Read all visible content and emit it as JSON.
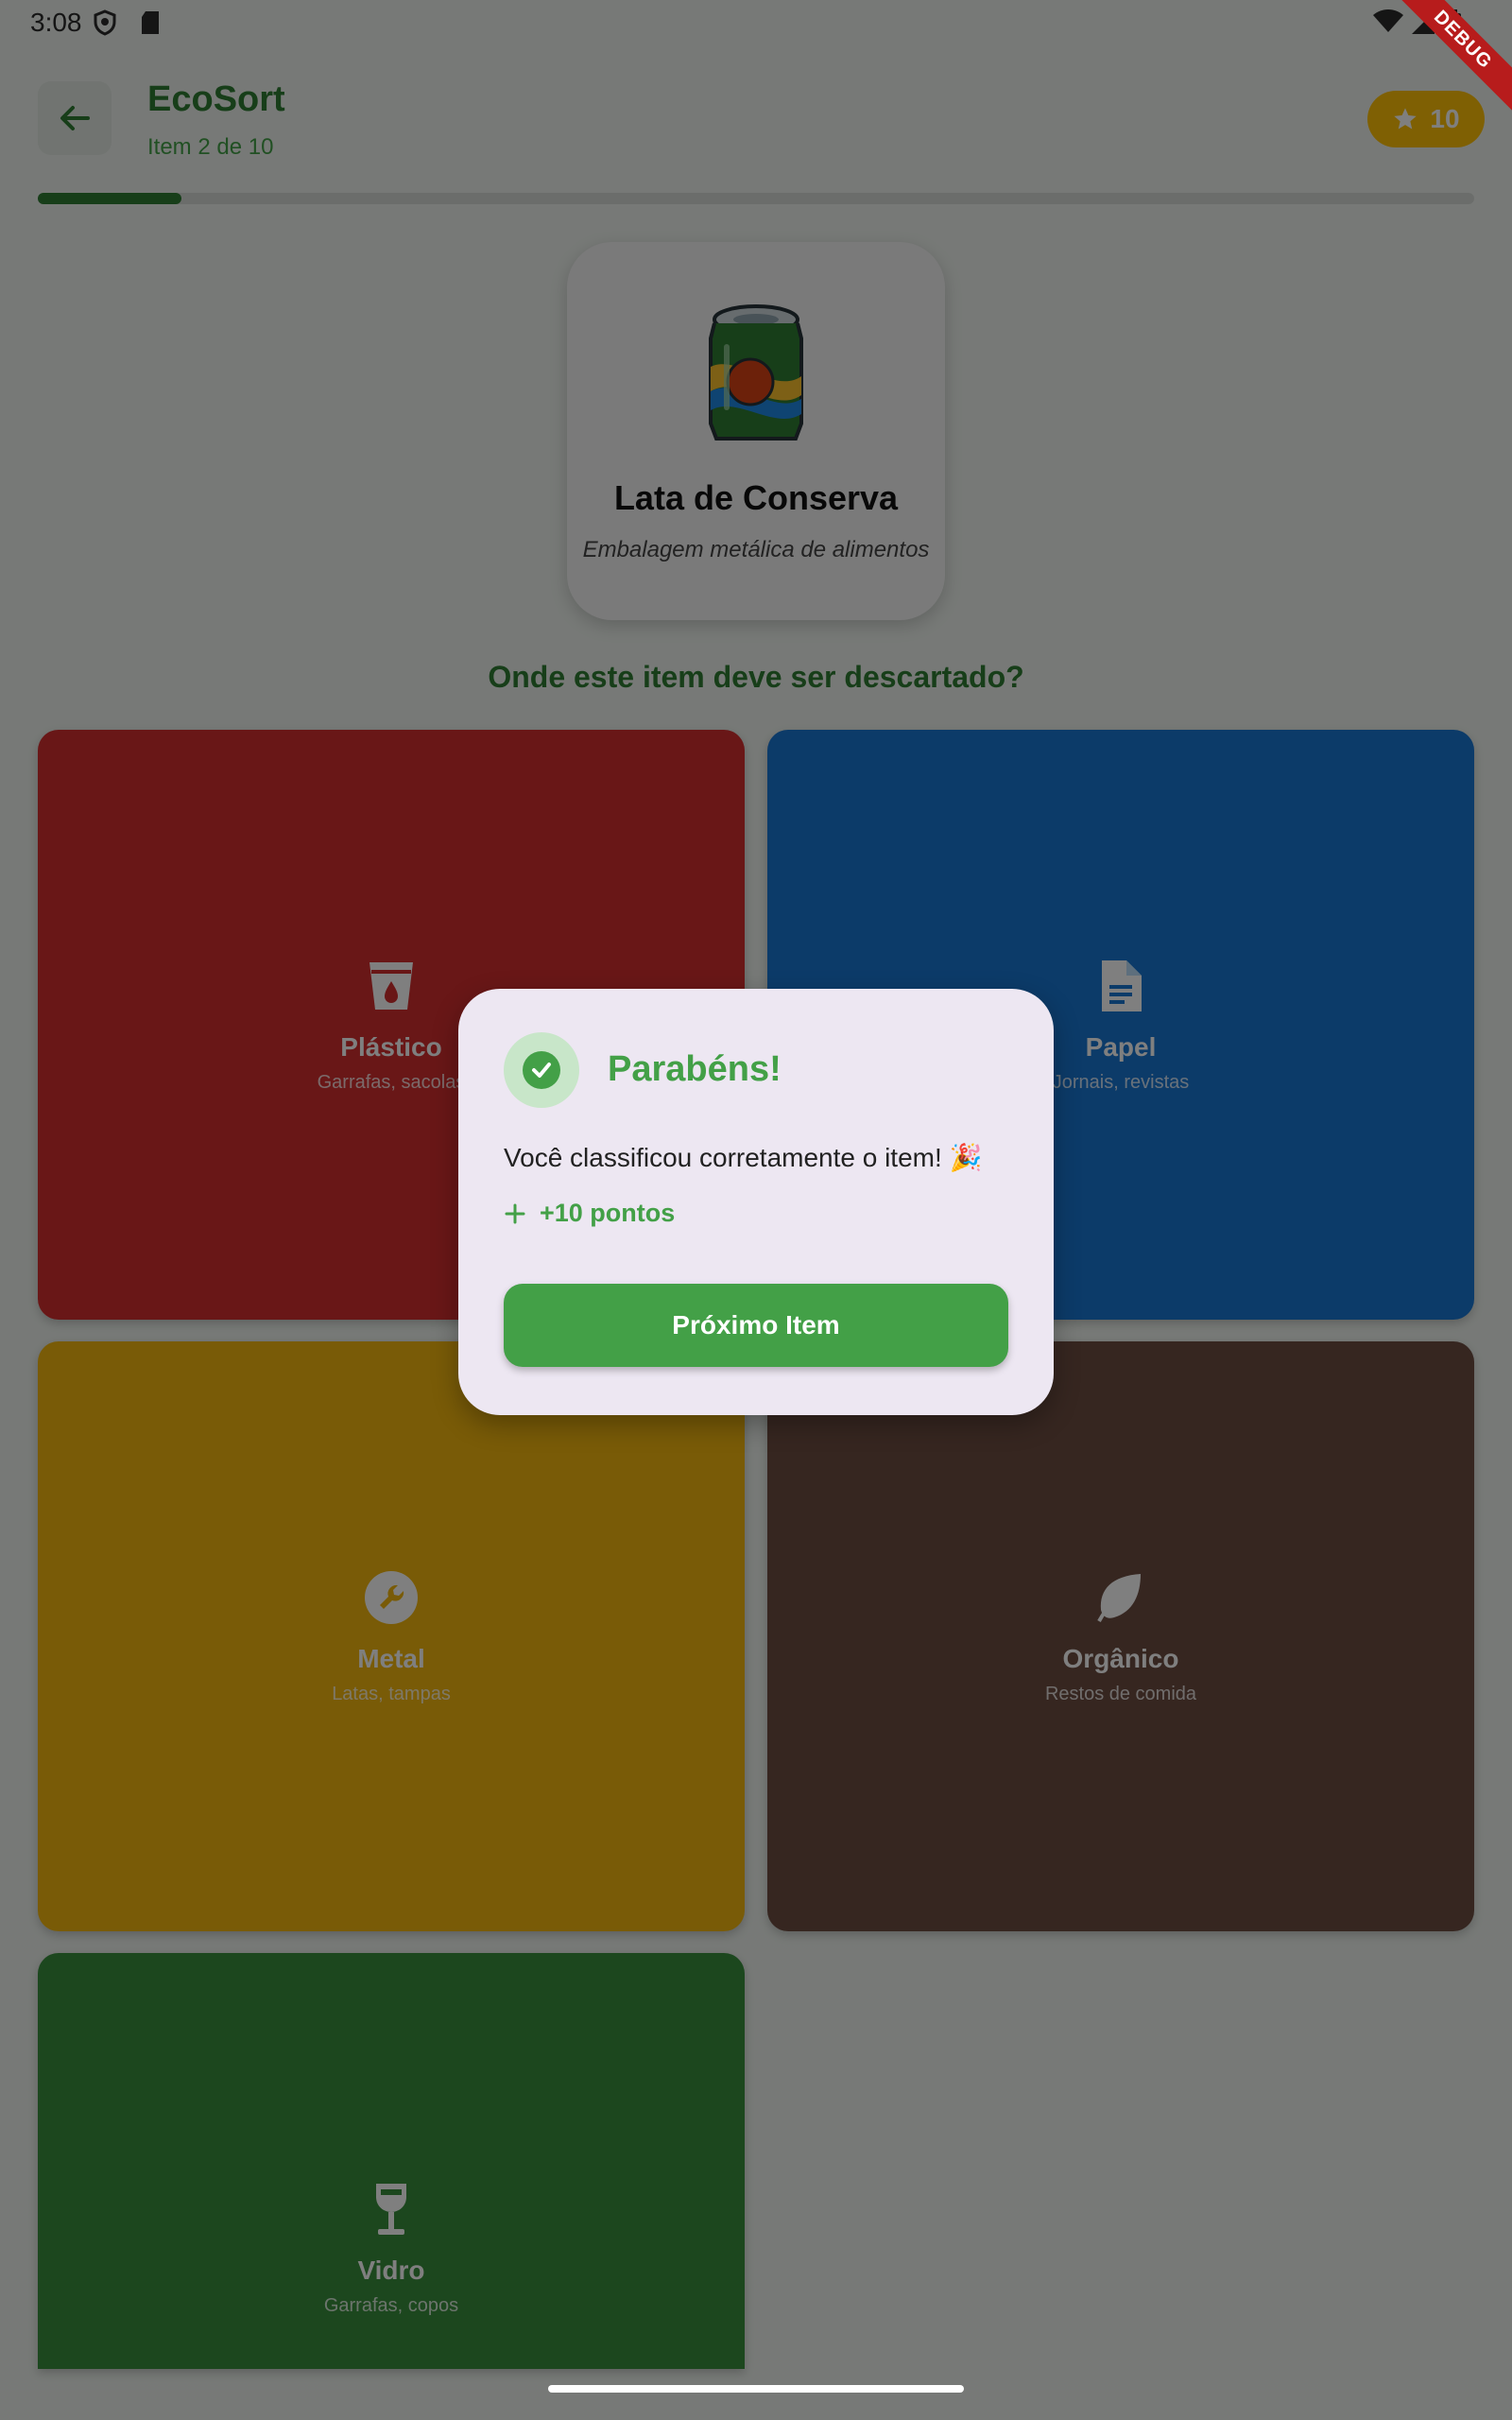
{
  "status_bar": {
    "time": "3:08"
  },
  "debug_banner": "DEBUG",
  "header": {
    "title": "EcoSort",
    "subtitle": "Item 2 de 10",
    "score": "10",
    "progress_fraction": 0.1
  },
  "item": {
    "name": "Lata de Conserva",
    "description": "Embalagem metálica de alimentos",
    "icon": "soda-can-icon"
  },
  "question": "Onde este item deve ser descartado?",
  "bins": [
    {
      "label": "Plástico",
      "sub": "Garrafas, sacolas",
      "color": "#d32f2f",
      "icon": "cup-icon"
    },
    {
      "label": "Papel",
      "sub": "Jornais, revistas",
      "color": "#1976d2",
      "icon": "document-icon"
    },
    {
      "label": "Metal",
      "sub": "Latas, tampas",
      "color": "#f2b70f",
      "icon": "wrench-icon"
    },
    {
      "label": "Orgânico",
      "sub": "Restos de comida",
      "color": "#6d4c41",
      "icon": "leaf-icon"
    },
    {
      "label": "Vidro",
      "sub": "Garrafas, copos",
      "color": "#388e3c",
      "icon": "wine-glass-icon"
    }
  ],
  "dialog": {
    "title": "Parabéns!",
    "message": "Você classificou corretamente o item! 🎉",
    "points": "+10 pontos",
    "button": "Próximo Item",
    "accent": "#43a047"
  }
}
